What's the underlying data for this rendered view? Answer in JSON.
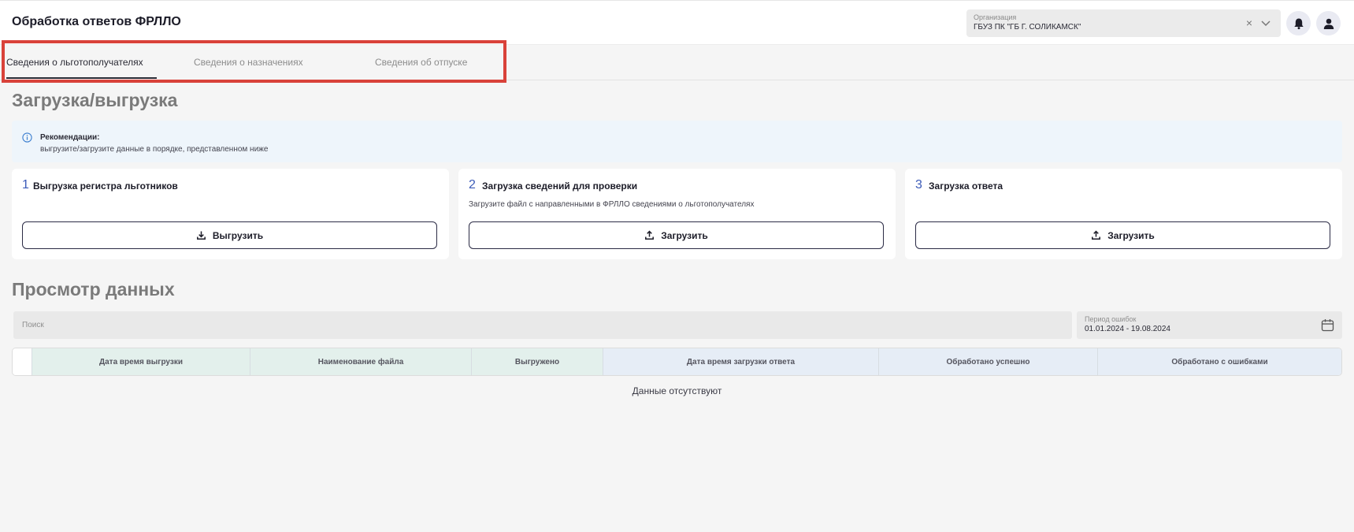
{
  "header": {
    "title": "Обработка ответов ФРЛЛО",
    "organization": {
      "label": "Организация",
      "value": "ГБУЗ ПК \"ГБ Г. СОЛИКАМСК\"",
      "clear_glyph": "×"
    },
    "icons": [
      "bell-icon",
      "user-icon",
      "chevron-down-icon",
      "close-icon"
    ]
  },
  "tabs": [
    {
      "label": "Сведения о льготополучателях",
      "active": true
    },
    {
      "label": "Сведения о назначениях",
      "active": false
    },
    {
      "label": "Сведения об отпуске",
      "active": false
    }
  ],
  "upload_section": {
    "title": "Загрузка/выгрузка",
    "recommendation": {
      "title": "Рекомендации:",
      "text": "выгрузите/загрузите данные в порядке, представленном ниже"
    },
    "cards": [
      {
        "num": "1",
        "title": "Выгрузка регистра льготников",
        "desc": "",
        "button": "Выгрузить",
        "button_icon": "download-icon"
      },
      {
        "num": "2",
        "title": "Загрузка сведений для проверки",
        "desc": "Загрузите файл с направленными в ФРЛЛО сведениями о льготополучателях",
        "button": "Загрузить",
        "button_icon": "upload-icon"
      },
      {
        "num": "3",
        "title": "Загрузка ответа",
        "desc": "",
        "button": "Загрузить",
        "button_icon": "upload-icon"
      }
    ]
  },
  "data_section": {
    "title": "Просмотр данных",
    "search_placeholder": "Поиск",
    "period": {
      "label": "Период ошибок",
      "value": "01.01.2024 - 19.08.2024"
    },
    "columns": [
      "Дата время выгрузки",
      "Наименование файла",
      "Выгружено",
      "Дата время загрузки ответа",
      "Обработано успешно",
      "Обработано с ошибками"
    ],
    "empty_text": "Данные отсутствуют"
  },
  "colors": {
    "accent": "#3c5bb8",
    "highlight": "#d9423a",
    "head_green": "#e3f0ec",
    "head_blue": "#e6edf6"
  }
}
